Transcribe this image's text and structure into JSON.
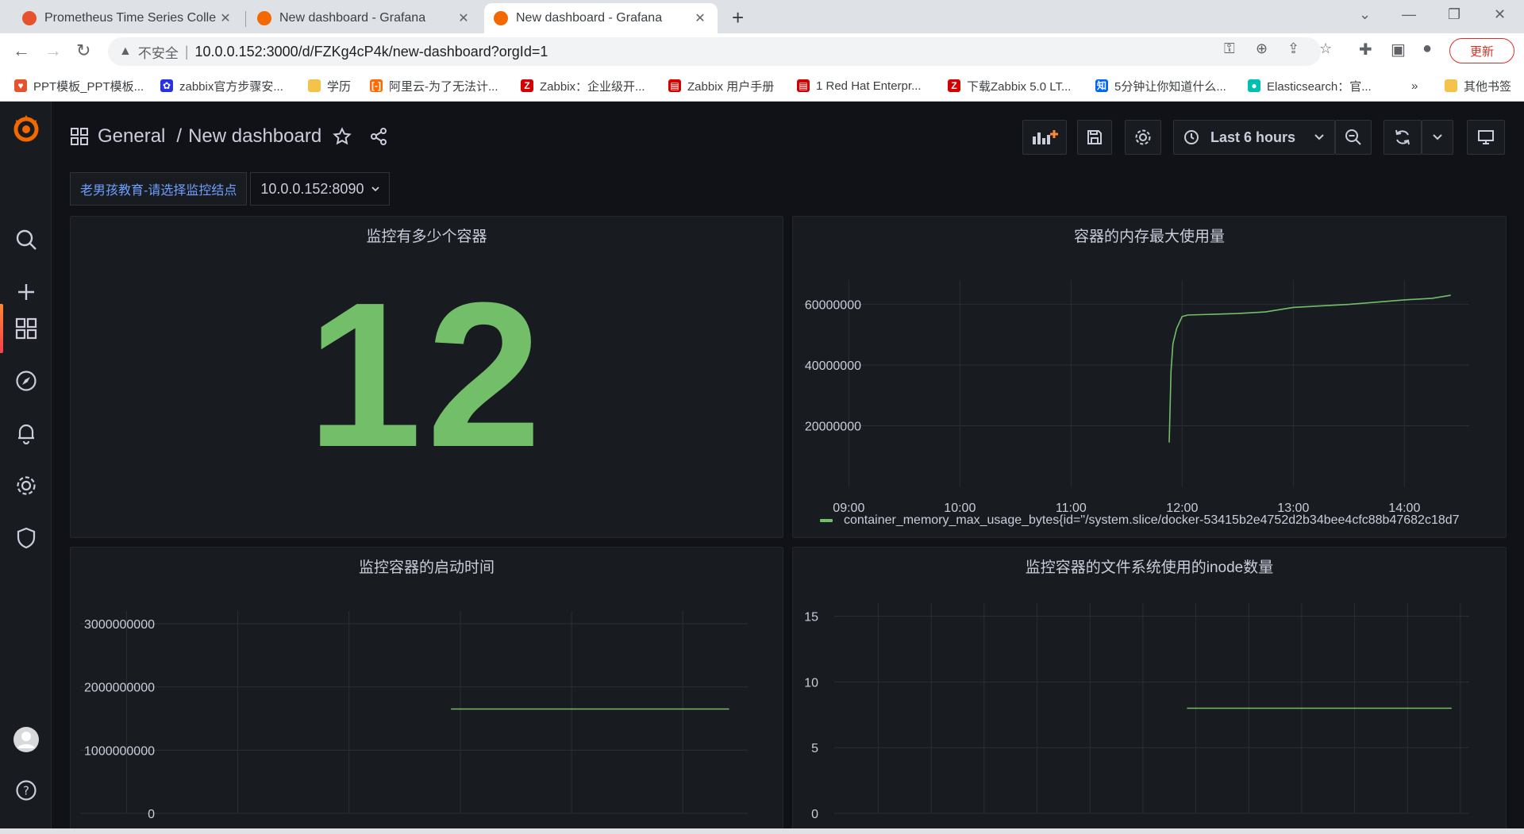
{
  "browser": {
    "tabs": [
      {
        "title": "Prometheus Time Series Colle",
        "active": false,
        "favicon_color": "#e6522c"
      },
      {
        "title": "New dashboard - Grafana",
        "active": false,
        "favicon_color": "#f46800"
      },
      {
        "title": "New dashboard - Grafana",
        "active": true,
        "favicon_color": "#f46800"
      }
    ],
    "insecure_label": "不安全",
    "url": "10.0.0.152:3000/d/FZKg4cP4k/new-dashboard?orgId=1",
    "update_label": "更新",
    "bookmarks": [
      {
        "label": "PPT模板_PPT模板...",
        "icon_color": "#e6522c",
        "icon": "heart-icon"
      },
      {
        "label": "zabbix官方步骤安...",
        "icon_color": "#2932e1",
        "icon": "paw-icon"
      },
      {
        "label": "学历",
        "icon_color": "#f6c34a",
        "icon": "folder-icon"
      },
      {
        "label": "阿里云-为了无法计...",
        "icon_color": "#ff6a00",
        "icon": "aliyun-icon"
      },
      {
        "label": "Zabbix：企业级开...",
        "icon_color": "#d40000",
        "icon": "zabbix-icon"
      },
      {
        "label": "Zabbix 用户手册",
        "icon_color": "#d40000",
        "icon": "book-icon"
      },
      {
        "label": "1 Red Hat Enterpr...",
        "icon_color": "#d40000",
        "icon": "redhat-icon"
      },
      {
        "label": "下载Zabbix 5.0 LT...",
        "icon_color": "#d40000",
        "icon": "zabbix-icon"
      },
      {
        "label": "5分钟让你知道什么...",
        "icon_color": "#0066ff",
        "icon": "zhihu-icon"
      },
      {
        "label": "Elasticsearch：官...",
        "icon_color": "#00bfb3",
        "icon": "elastic-icon"
      }
    ],
    "bookmarks_more": "»",
    "other_bookmarks": "其他书签"
  },
  "grafana": {
    "breadcrumb_folder": "General",
    "breadcrumb_sep": "/",
    "dashboard_title": "New dashboard",
    "time_range": "Last 6 hours",
    "variable_label": "老男孩教育-请选择监控结点",
    "variable_value": "10.0.0.152:8090",
    "accent": "#73bf69"
  },
  "panels": {
    "stat": {
      "title": "监控有多少个容器",
      "value": "12"
    },
    "memory": {
      "title": "容器的内存最大使用量",
      "legend": "container_memory_max_usage_bytes{id=\"/system.slice/docker-53415b2e4752d2b34bee4cfc88b47682c18d7"
    },
    "start_time": {
      "title": "监控容器的启动时间"
    },
    "inode": {
      "title": "监控容器的文件系统使用的inode数量"
    }
  },
  "chart_data": [
    {
      "type": "line",
      "title": "容器的内存最大使用量",
      "x_ticks": [
        "09:00",
        "10:00",
        "11:00",
        "12:00",
        "13:00",
        "14:00"
      ],
      "y_ticks": [
        "20000000",
        "40000000",
        "60000000"
      ],
      "y_tick_values": [
        20000000,
        40000000,
        60000000
      ],
      "series": [
        {
          "name": "container_memory_max_usage_bytes{id=\"/system.slice/docker-53415b2e4752d2b34bee4cfc88b47682c18d7",
          "x": [
            "11:53",
            "11:54",
            "11:55",
            "11:57",
            "12:00",
            "12:03",
            "12:30",
            "12:45",
            "13:00",
            "13:30",
            "14:00",
            "14:15",
            "14:25"
          ],
          "y": [
            14500000,
            38000000,
            47000000,
            52000000,
            56000000,
            56500000,
            57000000,
            57500000,
            59000000,
            60000000,
            61500000,
            62000000,
            63000000
          ]
        }
      ],
      "ylim": [
        0,
        68000000
      ]
    },
    {
      "type": "line",
      "title": "监控容器的启动时间",
      "y_ticks": [
        "0",
        "1000000000",
        "2000000000",
        "3000000000"
      ],
      "y_tick_values": [
        0,
        1000000000,
        2000000000,
        3000000000
      ],
      "series": [
        {
          "x": [
            "11:55",
            "14:25"
          ],
          "y": [
            1650000000,
            1650000000
          ]
        }
      ],
      "ylim": [
        0,
        3200000000
      ]
    },
    {
      "type": "line",
      "title": "监控容器的文件系统使用的inode数量",
      "y_ticks": [
        "0",
        "5",
        "10",
        "15"
      ],
      "y_tick_values": [
        0,
        5,
        10,
        15
      ],
      "series": [
        {
          "x": [
            "11:55",
            "14:25"
          ],
          "y": [
            8,
            8
          ]
        }
      ],
      "ylim": [
        0,
        16
      ]
    }
  ]
}
